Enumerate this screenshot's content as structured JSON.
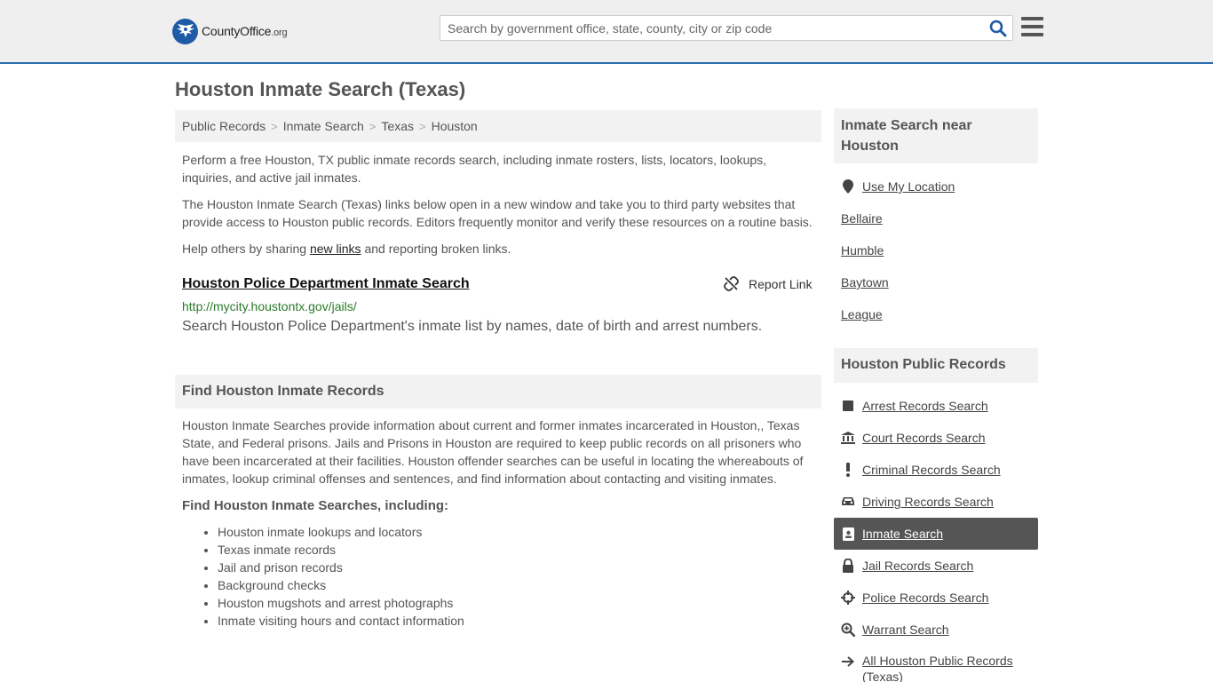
{
  "header": {
    "logo_main": "CountyOffice",
    "logo_tld": ".org",
    "search_placeholder": "Search by government office, state, county, city or zip code"
  },
  "main": {
    "title": "Houston Inmate Search (Texas)",
    "breadcrumb": [
      "Public Records",
      "Inmate Search",
      "Texas",
      "Houston"
    ],
    "intro1": "Perform a free Houston, TX public inmate records search, including inmate rosters, lists, locators, lookups, inquiries, and active jail inmates.",
    "intro2": "The Houston Inmate Search (Texas) links below open in a new window and take you to third party websites that provide access to Houston public records. Editors frequently monitor and verify these resources on a routine basis.",
    "share_pre": "Help others by sharing ",
    "share_link": "new links",
    "share_post": " and reporting broken links.",
    "result": {
      "title": "Houston Police Department Inmate Search",
      "report": "Report Link",
      "url": "http://mycity.houstontx.gov/jails/",
      "description": "Search Houston Police Department's inmate list by names, date of birth and arrest numbers."
    },
    "section_title": "Find Houston Inmate Records",
    "section_text": "Houston Inmate Searches provide information about current and former inmates incarcerated in Houston,, Texas State, and Federal prisons. Jails and Prisons in Houston are required to keep public records on all prisoners who have been incarcerated at their facilities. Houston offender searches can be useful in locating the whereabouts of inmates, lookup criminal offenses and sentences, and find information about contacting and visiting inmates.",
    "sub_title": "Find Houston Inmate Searches, including:",
    "bullets": [
      "Houston inmate lookups and locators",
      "Texas inmate records",
      "Jail and prison records",
      "Background checks",
      "Houston mugshots and arrest photographs",
      "Inmate visiting hours and contact information"
    ]
  },
  "sidebar": {
    "near_title": "Inmate Search near Houston",
    "use_location": "Use My Location",
    "near": [
      "Bellaire",
      "Humble",
      "Baytown",
      "League"
    ],
    "records_title": "Houston Public Records",
    "records": [
      {
        "label": "Arrest Records Search",
        "icon": "square-icon"
      },
      {
        "label": "Court Records Search",
        "icon": "courthouse-icon"
      },
      {
        "label": "Criminal Records Search",
        "icon": "exclamation-icon"
      },
      {
        "label": "Driving Records Search",
        "icon": "car-icon"
      },
      {
        "label": "Inmate Search",
        "icon": "id-badge-icon",
        "active": true
      },
      {
        "label": "Jail Records Search",
        "icon": "lock-icon"
      },
      {
        "label": "Police Records Search",
        "icon": "crosshair-icon"
      },
      {
        "label": "Warrant Search",
        "icon": "search-plus-icon"
      },
      {
        "label": "All Houston Public Records (Texas)",
        "icon": "arrow-right-icon"
      }
    ]
  }
}
